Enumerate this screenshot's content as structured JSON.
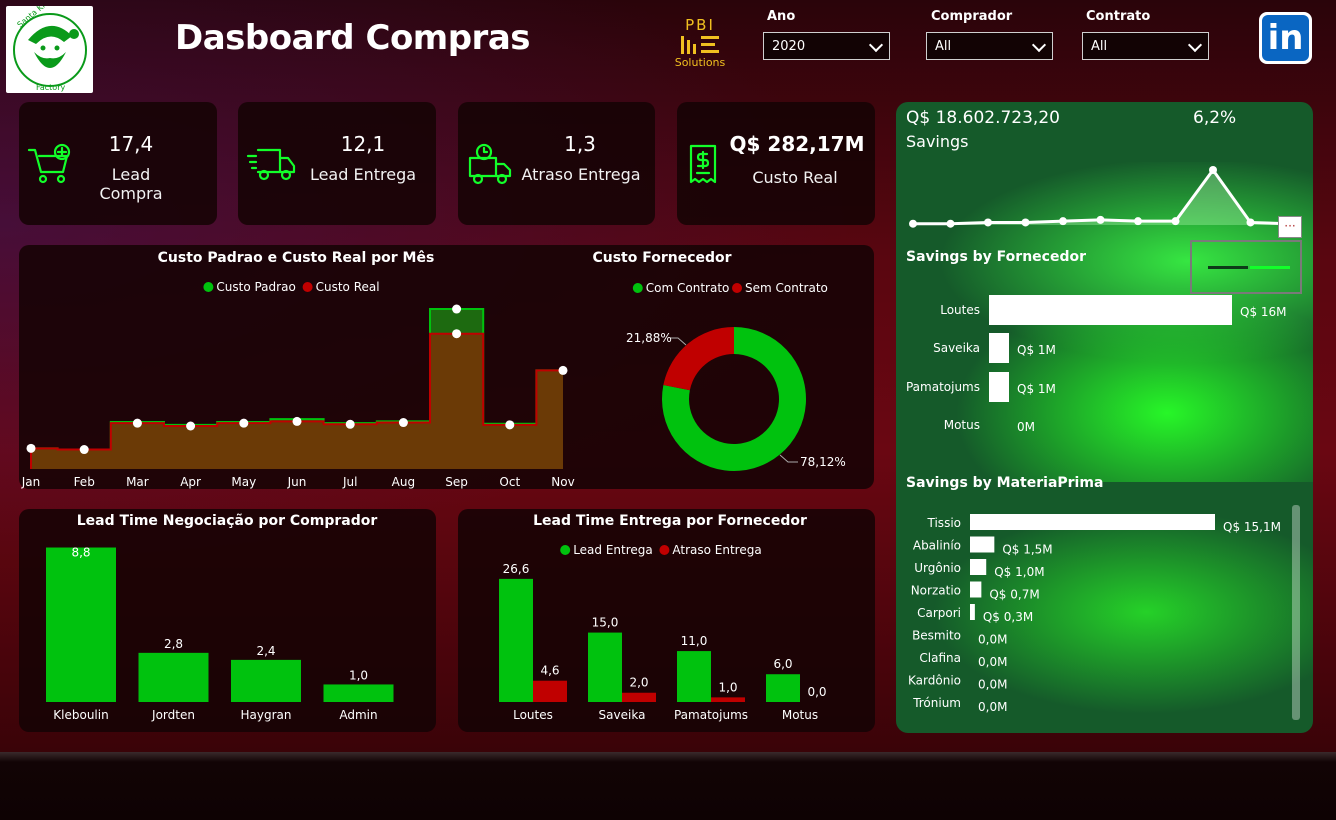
{
  "header": {
    "title": "Dasboard Compras",
    "logo_text_top": "Santa Klaus",
    "logo_text_bottom": "Factory",
    "pbi_text": "PBI",
    "pbi_sub": "Solutions"
  },
  "filters": [
    {
      "label": "Ano",
      "value": "2020"
    },
    {
      "label": "Comprador",
      "value": "All"
    },
    {
      "label": "Contrato",
      "value": "All"
    }
  ],
  "social": {
    "linkedin_text": "in"
  },
  "kpis": [
    {
      "value": "17,4",
      "label": "Lead Compra",
      "icon": "cart-plus-icon"
    },
    {
      "value": "12,1",
      "label": "Lead Entrega",
      "icon": "delivery-truck-icon"
    },
    {
      "value": "1,3",
      "label": "Atraso Entrega",
      "icon": "truck-clock-icon"
    },
    {
      "value": "Q$ 282,17M",
      "label": "Custo Real",
      "icon": "receipt-dollar-icon"
    }
  ],
  "savings": {
    "value": "Q$ 18.602.723,20",
    "label": "Savings",
    "pct": "6,2%",
    "more_label": "···"
  },
  "colors": {
    "green": "#00c20e",
    "red": "#c00000",
    "brown": "#6b3a06",
    "white": "#ffffff",
    "panel": "#155a2a"
  },
  "chart_data": [
    {
      "type": "area",
      "title": "Custo Padrao e Custo Real por Mês",
      "categories": [
        "Jan",
        "Feb",
        "Mar",
        "Apr",
        "May",
        "Jun",
        "Jul",
        "Aug",
        "Sep",
        "Oct",
        "Nov"
      ],
      "series": [
        {
          "name": "Custo Padrao",
          "values": [
            3.6,
            3.4,
            8.2,
            7.7,
            8.2,
            8.7,
            8.0,
            8.3,
            27.9,
            7.9,
            17.2
          ]
        },
        {
          "name": "Custo Real",
          "values": [
            3.6,
            3.4,
            8.0,
            7.5,
            8.0,
            8.3,
            7.8,
            8.1,
            23.6,
            7.7,
            17.2
          ]
        }
      ],
      "ylim": [
        0,
        30
      ],
      "legend": "top-center"
    },
    {
      "type": "pie",
      "title": "Custo Fornecedor",
      "donut": true,
      "slices": [
        {
          "name": "Com Contrato",
          "value": 78.12,
          "label": "78,12%"
        },
        {
          "name": "Sem Contrato",
          "value": 21.88,
          "label": "21,88%"
        }
      ],
      "legend": "top-center"
    },
    {
      "type": "bar",
      "title": "Lead Time Negociação por Comprador",
      "categories": [
        "Kleboulin",
        "Jordten",
        "Haygran",
        "Admin"
      ],
      "values": [
        8.8,
        2.8,
        2.4,
        1.0
      ],
      "value_labels": [
        "8,8",
        "2,8",
        "2,4",
        "1,0"
      ],
      "ylim": [
        0,
        9
      ]
    },
    {
      "type": "bar",
      "title": "Lead Time Entrega por Fornecedor",
      "categories": [
        "Loutes",
        "Saveika",
        "Pamatojums",
        "Motus"
      ],
      "series": [
        {
          "name": "Lead Entrega",
          "values": [
            26.6,
            15.0,
            11.0,
            6.0
          ],
          "labels": [
            "26,6",
            "15,0",
            "11,0",
            "6,0"
          ]
        },
        {
          "name": "Atraso Entrega",
          "values": [
            4.6,
            2.0,
            1.0,
            0.0
          ],
          "labels": [
            "4,6",
            "2,0",
            "1,0",
            "0,0"
          ]
        }
      ],
      "ylim": [
        0,
        28
      ],
      "legend": "top-center"
    },
    {
      "type": "line",
      "title": "",
      "x": [
        1,
        2,
        3,
        4,
        5,
        6,
        7,
        8,
        9,
        10,
        11
      ],
      "values": [
        0.1,
        0.1,
        0.2,
        0.2,
        0.3,
        0.4,
        0.3,
        0.3,
        4.3,
        0.2,
        0.1
      ]
    },
    {
      "type": "bar",
      "orientation": "horizontal",
      "title": "Savings by Fornecedor",
      "categories": [
        "Loutes",
        "Saveika",
        "Pamatojums",
        "Motus"
      ],
      "values": [
        16,
        1.3,
        1.1,
        0
      ],
      "value_labels": [
        "Q$ 16M",
        "Q$ 1M",
        "Q$ 1M",
        "0M"
      ]
    },
    {
      "type": "bar",
      "orientation": "horizontal",
      "title": "Savings by MateriaPrima",
      "categories": [
        "Tissio",
        "Abalinío",
        "Urgônio",
        "Norzatio",
        "Carpori",
        "Besmito",
        "Clafina",
        "Kardônio",
        "Trónium"
      ],
      "values": [
        15.1,
        1.5,
        1.0,
        0.7,
        0.3,
        0,
        0,
        0,
        0
      ],
      "value_labels": [
        "Q$ 15,1M",
        "Q$ 1,5M",
        "Q$ 1,0M",
        "Q$ 0,7M",
        "Q$ 0,3M",
        "0,0M",
        "0,0M",
        "0,0M",
        "0,0M"
      ]
    }
  ]
}
